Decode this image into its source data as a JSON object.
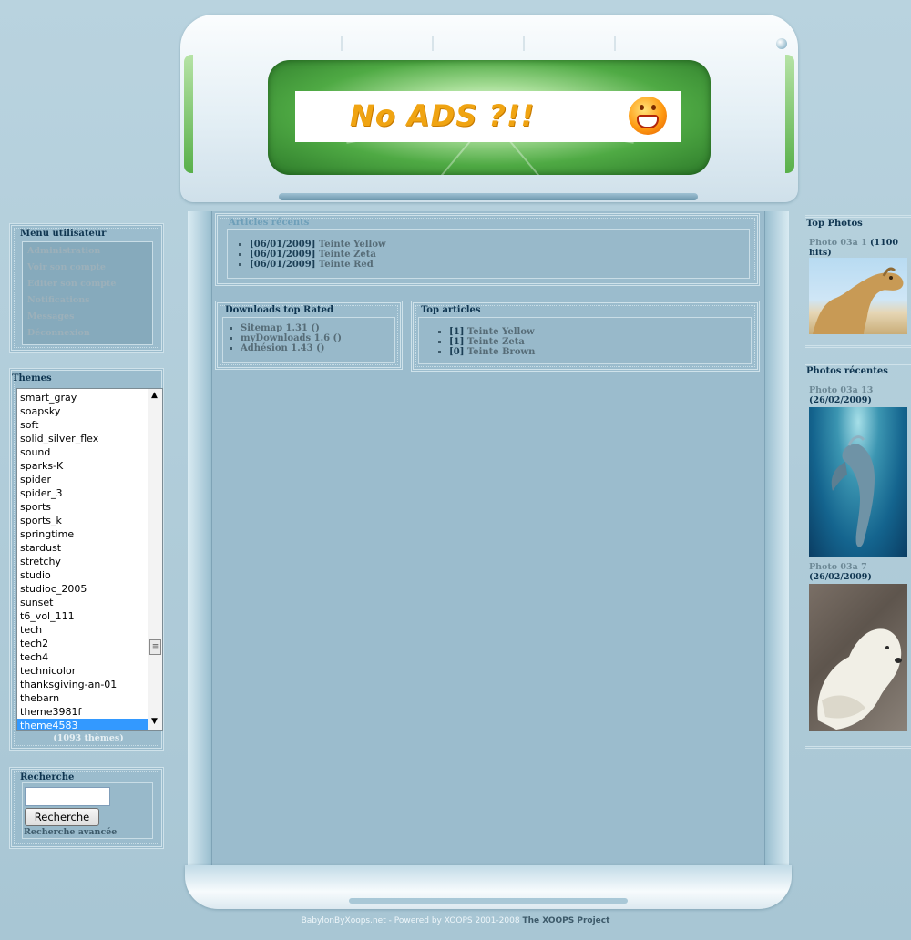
{
  "header": {
    "banner_text": "No ADS ?!!"
  },
  "user_menu": {
    "title": "Menu utilisateur",
    "items": [
      "Administration",
      "Voir son compte",
      "Editer son compte",
      "Notifications",
      "Messages",
      "Déconnexion"
    ]
  },
  "themes": {
    "title": "Themes",
    "options": [
      "smart_gray",
      "soapsky",
      "soft",
      "solid_silver_flex",
      "sound",
      "sparks-K",
      "spider",
      "spider_3",
      "sports",
      "sports_k",
      "springtime",
      "stardust",
      "stretchy",
      "studio",
      "studioc_2005",
      "sunset",
      "t6_vol_111",
      "tech",
      "tech2",
      "tech4",
      "technicolor",
      "thanksgiving-an-01",
      "thebarn",
      "theme3981f",
      "theme4583"
    ],
    "selected": "theme4583",
    "count": "(1093 thèmes)"
  },
  "search": {
    "title": "Recherche",
    "button_label": "Recherche",
    "advanced_label": "Recherche avancée",
    "input_value": ""
  },
  "recent_articles": {
    "title": "Articles récents",
    "items": [
      {
        "date": "[06/01/2009]",
        "title": "Teinte Yellow"
      },
      {
        "date": "[06/01/2009]",
        "title": "Teinte Zeta"
      },
      {
        "date": "[06/01/2009]",
        "title": "Teinte Red"
      }
    ]
  },
  "downloads_top_rated": {
    "title": "Downloads top Rated",
    "items": [
      "Sitemap 1.31 ()",
      "myDownloads 1.6 ()",
      "Adhésion 1.43 ()"
    ]
  },
  "top_articles": {
    "title": "Top articles",
    "items": [
      {
        "count": "[1]",
        "title": "Teinte Yellow"
      },
      {
        "count": "[1]",
        "title": "Teinte Zeta"
      },
      {
        "count": "[0]",
        "title": "Teinte Brown"
      }
    ]
  },
  "top_photos": {
    "title": "Top Photos",
    "items": [
      {
        "name": "Photo 03a 1",
        "hits": "(1100 hits)"
      }
    ]
  },
  "recent_photos": {
    "title": "Photos récentes",
    "items": [
      {
        "name": "Photo 03a 13",
        "date": "(26/02/2009)"
      },
      {
        "name": "Photo 03a 7",
        "date": "(26/02/2009)"
      }
    ]
  },
  "footer": {
    "text": "BabylonByXoops.net - Powered by XOOPS 2001-2008",
    "project": "The XOOPS Project"
  }
}
